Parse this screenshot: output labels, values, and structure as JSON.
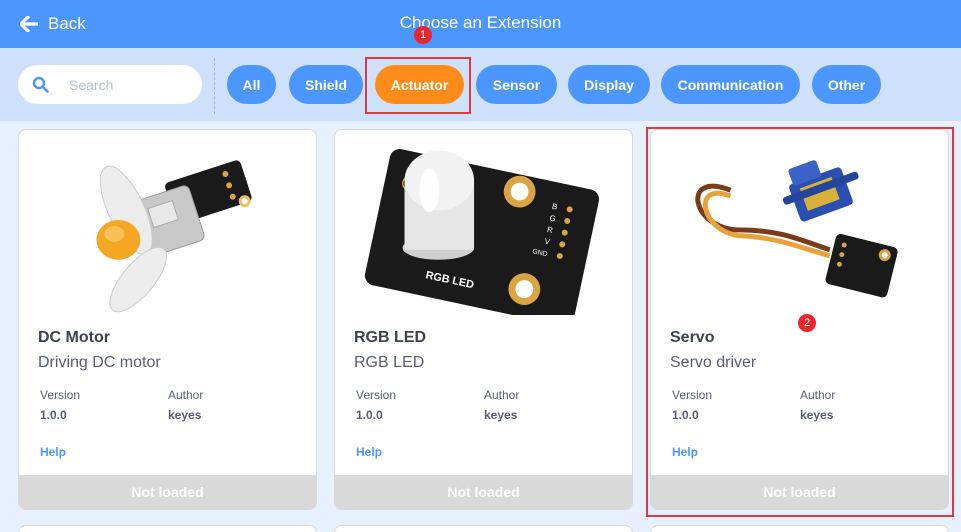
{
  "header": {
    "back_label": "Back",
    "title": "Choose an Extension"
  },
  "search": {
    "placeholder": "Search",
    "value": ""
  },
  "categories": [
    "All",
    "Shield",
    "Actuator",
    "Sensor",
    "Display",
    "Communication",
    "Other"
  ],
  "active_category": "Actuator",
  "annotations": [
    "1",
    "2"
  ],
  "cards": [
    {
      "name": "DC Motor",
      "description": "Driving DC motor",
      "version_label": "Version",
      "version": "1.0.0",
      "author_label": "Author",
      "author": "keyes",
      "help_label": "Help",
      "status": "Not loaded"
    },
    {
      "name": "RGB LED",
      "description": "RGB LED",
      "version_label": "Version",
      "version": "1.0.0",
      "author_label": "Author",
      "author": "keyes",
      "help_label": "Help",
      "status": "Not loaded",
      "image_text": "RGB LED",
      "pin_labels": [
        "B",
        "G",
        "R",
        "V",
        "GND"
      ]
    },
    {
      "name": "Servo",
      "description": "Servo driver",
      "version_label": "Version",
      "version": "1.0.0",
      "author_label": "Author",
      "author": "keyes",
      "help_label": "Help",
      "status": "Not loaded"
    }
  ],
  "colors": {
    "primary": "#4c97ff",
    "active": "#ff8c1a",
    "highlight": "#e0393e",
    "filter_bg": "#cfe0fb",
    "page_bg": "#e6f0ff"
  }
}
